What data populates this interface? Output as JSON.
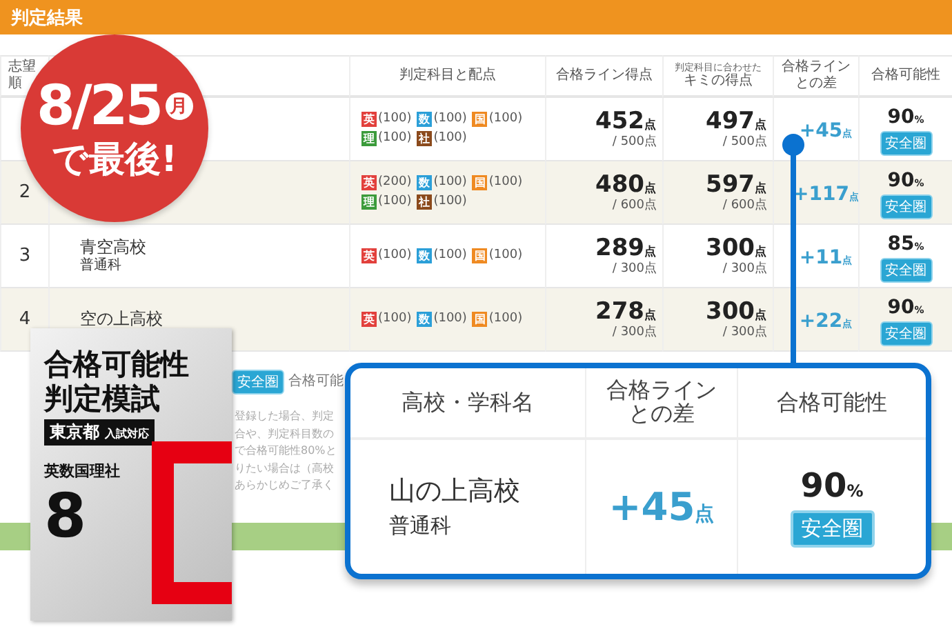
{
  "header": {
    "title": "判定結果"
  },
  "table": {
    "columns": {
      "rank": [
        "志望",
        "順"
      ],
      "subjects": "判定科目と配点",
      "line_score": "合格ライン得点",
      "your_score_note": "判定科目に合わせた",
      "your_score": "キミの得点",
      "difference": [
        "合格ライン",
        "との差"
      ],
      "possibility": "合格可能性"
    },
    "rows": [
      {
        "subjects": [
          {
            "tag": "英",
            "points": "(100)",
            "color": "#e2403c"
          },
          {
            "tag": "数",
            "points": "(100)",
            "color": "#2b9fd8"
          },
          {
            "tag": "国",
            "points": "(100)",
            "color": "#ef8a22"
          },
          {
            "tag": "理",
            "points": "(100)",
            "color": "#3b9b3b"
          },
          {
            "tag": "社",
            "points": "(100)",
            "color": "#8b4a1c"
          }
        ],
        "line_score": "452",
        "line_unit": "点",
        "line_total": "/ 500点",
        "your_score": "497",
        "your_unit": "点",
        "your_total": "/ 500点",
        "difference": "+45",
        "difference_unit": "点",
        "possibility": "90",
        "possibility_unit": "%",
        "zone": "安全圏"
      },
      {
        "rank": "2",
        "subjects": [
          {
            "tag": "英",
            "points": "(200)",
            "color": "#e2403c"
          },
          {
            "tag": "数",
            "points": "(100)",
            "color": "#2b9fd8"
          },
          {
            "tag": "国",
            "points": "(100)",
            "color": "#ef8a22"
          },
          {
            "tag": "理",
            "points": "(100)",
            "color": "#3b9b3b"
          },
          {
            "tag": "社",
            "points": "(100)",
            "color": "#8b4a1c"
          }
        ],
        "line_score": "480",
        "line_unit": "点",
        "line_total": "/ 600点",
        "your_score": "597",
        "your_unit": "点",
        "your_total": "/ 600点",
        "difference": "+117",
        "difference_unit": "点",
        "possibility": "90",
        "possibility_unit": "%",
        "zone": "安全圏"
      },
      {
        "rank": "3",
        "school": "青空高校",
        "department": "普通科",
        "subjects": [
          {
            "tag": "英",
            "points": "(100)",
            "color": "#e2403c"
          },
          {
            "tag": "数",
            "points": "(100)",
            "color": "#2b9fd8"
          },
          {
            "tag": "国",
            "points": "(100)",
            "color": "#ef8a22"
          }
        ],
        "line_score": "289",
        "line_unit": "点",
        "line_total": "/ 300点",
        "your_score": "300",
        "your_unit": "点",
        "your_total": "/ 300点",
        "difference": "+11",
        "difference_unit": "点",
        "possibility": "85",
        "possibility_unit": "%",
        "zone": "安全圏"
      },
      {
        "rank": "4",
        "school": "空の上高校",
        "subjects": [
          {
            "tag": "英",
            "points": "(100)",
            "color": "#e2403c"
          },
          {
            "tag": "数",
            "points": "(100)",
            "color": "#2b9fd8"
          },
          {
            "tag": "国",
            "points": "(100)",
            "color": "#ef8a22"
          }
        ],
        "line_score": "278",
        "line_unit": "点",
        "line_total": "/ 300点",
        "your_score": "300",
        "your_unit": "点",
        "your_total": "/ 300点",
        "difference": "+22",
        "difference_unit": "点",
        "possibility": "90",
        "possibility_unit": "%",
        "zone": "安全圏"
      }
    ]
  },
  "legend": {
    "zone": "安全圏",
    "text": "合格可能"
  },
  "notes": [
    "登録した場合、判定",
    "合や、判定科目数の",
    "で合格可能性80%と",
    "りたい場合は（高校",
    "あらかじめご了承く"
  ],
  "deadline_badge": {
    "date": "8/25",
    "weekday": "月",
    "text": "で最後!"
  },
  "book": {
    "title_1": "合格可能性",
    "title_2": "判定模試",
    "region": "東京都",
    "region_note": "入試対応",
    "subjects": "英数国理社",
    "number": "8"
  },
  "callout": {
    "columns": [
      [
        "高校・学科名"
      ],
      [
        "合格ライン",
        "との差"
      ],
      [
        "合格可能性"
      ]
    ],
    "school": "山の上高校",
    "department": "普通科",
    "difference": "+45",
    "difference_unit": "点",
    "possibility": "90",
    "possibility_unit": "%",
    "zone": "安全圏"
  }
}
